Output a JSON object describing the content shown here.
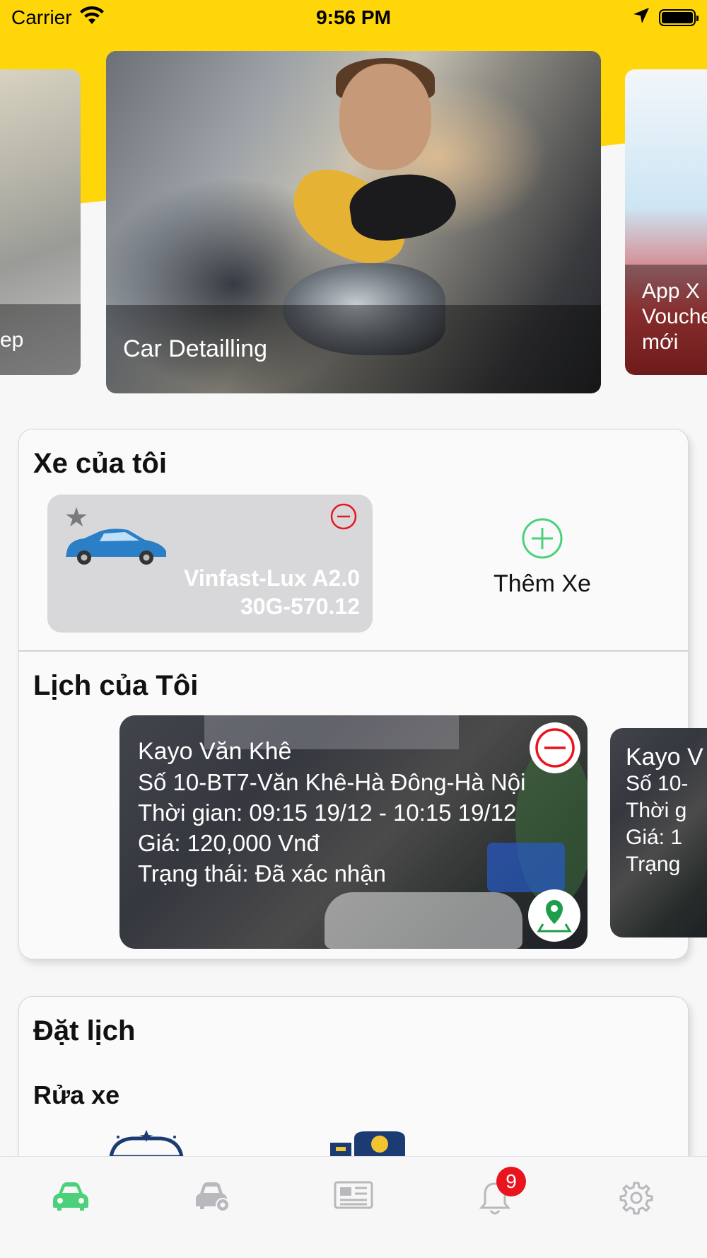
{
  "status_bar": {
    "carrier": "Carrier",
    "time": "9:56 PM"
  },
  "banners": [
    {
      "caption": "ep"
    },
    {
      "caption": "Car Detailling"
    },
    {
      "caption_lines": [
        "App X",
        "Vouche",
        "mới"
      ]
    }
  ],
  "my_vehicles": {
    "title": "Xe của tôi",
    "vehicles": [
      {
        "name": "Vinfast-Lux A2.0",
        "plate": "30G-570.12",
        "favorite": true,
        "icon": "car-icon"
      }
    ],
    "add_label": "Thêm Xe"
  },
  "my_schedule": {
    "title": "Lịch của Tôi",
    "bookings": [
      {
        "name": "Kayo Văn Khê",
        "address": "Số 10-BT7-Văn Khê-Hà Đông-Hà Nội",
        "time": "Thời gian: 09:15 19/12 - 10:15 19/12",
        "price": "Giá: 120,000 Vnđ",
        "status": "Trạng thái: Đã xác nhận"
      },
      {
        "name": "Kayo V",
        "address": "Số 10-",
        "time": "Thời g",
        "price": "Giá: 1",
        "status": "Trạng"
      }
    ]
  },
  "booking_section": {
    "title": "Đặt lịch",
    "subtitle": "Rửa xe"
  },
  "tab_bar": {
    "tabs": [
      {
        "icon": "car-icon",
        "active": true
      },
      {
        "icon": "car-service-icon",
        "active": false
      },
      {
        "icon": "news-icon",
        "active": false
      },
      {
        "icon": "bell-icon",
        "active": false,
        "badge": "9"
      },
      {
        "icon": "gear-icon",
        "active": false
      }
    ]
  },
  "colors": {
    "brand_yellow": "#ffd60a",
    "accent_green": "#4cd07a",
    "remove_red": "#e8141e",
    "inactive_gray": "#b9b9bd"
  }
}
